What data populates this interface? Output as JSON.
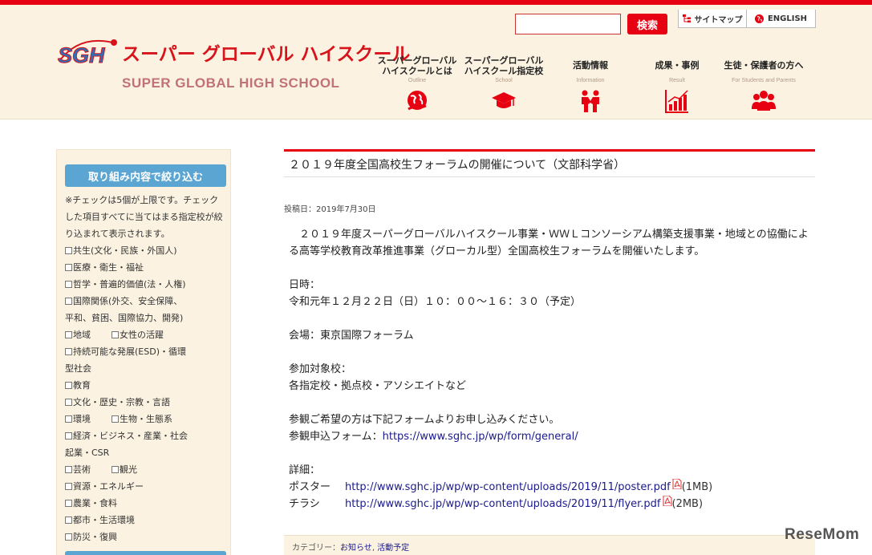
{
  "logo": {
    "mark": "SGH",
    "name_jp": "スーパー グローバル ハイスクール",
    "name_en": "SUPER GLOBAL HIGH SCHOOL"
  },
  "search": {
    "button_label": "検索",
    "value": "",
    "placeholder": ""
  },
  "utility": {
    "sitemap_label": "サイトマップ",
    "english_label": "ENGLISH"
  },
  "nav": [
    {
      "title": "スーパーグローバル\nハイスクールとは",
      "sub": "Outline",
      "icon": "globe-hand-icon"
    },
    {
      "title": "スーパーグローバル\nハイスクール指定校",
      "sub": "School",
      "icon": "graduation-cap-icon"
    },
    {
      "title": "活動情報",
      "sub": "Information",
      "icon": "people-hands-icon"
    },
    {
      "title": "成果・事例",
      "sub": "Result",
      "icon": "bar-chart-icon"
    },
    {
      "title": "生徒・保護者の方へ",
      "sub": "For Students and Parents",
      "icon": "group-icon"
    }
  ],
  "sidebar": {
    "filter_button": "取り組み内容で絞り込む",
    "note": "※チェックは5個が上限です。チェックした項目すべてに当てはまる指定校が絞り込まれて表示されます。",
    "checkboxes": {
      "c1": "共生(文化・民族・外国人)",
      "c2": "医療・衛生・福祉",
      "c3": "哲学・普遍的価値(法・人権)",
      "c4a": "国際関係(外交、安全保障、",
      "c4b": "平和、貧困、国際協力、開発)",
      "c5": "地域",
      "c6": "女性の活躍",
      "c7a": "持続可能な発展(ESD)・循環",
      "c7b": "型社会",
      "c8": "教育",
      "c9": "文化・歴史・宗教・言語",
      "c10": "環境",
      "c11": "生物・生態系",
      "c12a": "経済・ビジネス・産業・社会",
      "c12b": "起業・CSR",
      "c13": "芸術",
      "c14": "観光",
      "c15": "資源・エネルギー",
      "c16": "農業・食料",
      "c17": "都市・生活環境",
      "c18": "防災・復興"
    }
  },
  "article": {
    "title": "２０１９年度全国高校生フォーラムの開催について（文部科学省）",
    "posted_date": "投稿日：2019年7月30日",
    "intro": "２０１９年度スーパーグローバルハイスクール事業・ＷＷＬコンソーシアム構築支援事業・地域との協働による高等学校教育改革推進事業（グローカル型）全国高校生フォーラムを開催いたします。",
    "datetime_label": "日時：",
    "datetime_value": "令和元年１２月２２日（日）１０：００〜１６：３０（予定）",
    "venue": "会場：東京国際フォーラム",
    "target_label": "参加対象校：",
    "target_value": "各指定校・拠点校・アソシエイトなど",
    "apply_text": "参観ご希望の方は下記フォームよりお申し込みください。",
    "apply_label": "参観申込フォーム：",
    "apply_link": "https://www.sghc.jp/wp/form/general/",
    "details_label": "詳細：",
    "poster_label": "ポスター",
    "poster_link": "http://www.sghc.jp/wp/wp-content/uploads/2019/11/poster.pdf",
    "poster_size": "(1MB)",
    "flyer_label": "チラシ",
    "flyer_link": "http://www.sghc.jp/wp/wp-content/uploads/2019/11/flyer.pdf",
    "flyer_size": "(2MB)"
  },
  "category": {
    "label": "カテゴリー：",
    "cat1": "お知らせ",
    "sep": ", ",
    "cat2": "活動予定"
  },
  "watermark": "ReseMom",
  "colors": {
    "accent": "#e60012",
    "header_bg": "#fbf2e1",
    "filter_button": "#5aa5d1",
    "link": "#1a1a8c"
  }
}
